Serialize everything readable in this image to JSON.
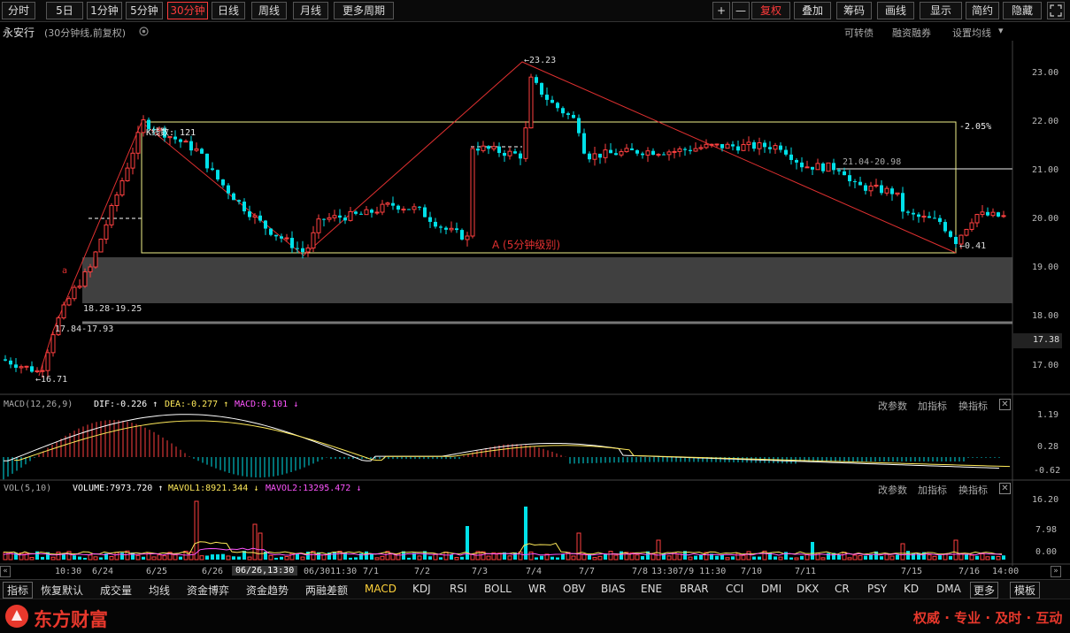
{
  "toolbar": {
    "periods": [
      "分时",
      "5日",
      "1分钟",
      "5分钟",
      "30分钟",
      "日线",
      "周线",
      "月线",
      "更多周期"
    ],
    "right": [
      "+",
      "—",
      "复权",
      "叠加",
      "筹码",
      "画线",
      "显示",
      "简约",
      "隐藏"
    ],
    "active_period": "30分钟"
  },
  "info": {
    "stock_name": "永安行",
    "mode": "(30分钟线,前复权)",
    "links": [
      "可转债",
      "融资融券",
      "设置均线"
    ]
  },
  "main_chart": {
    "yaxis": [
      "23.00",
      "22.00",
      "21.00",
      "20.00",
      "19.00",
      "18.00",
      "17.00"
    ],
    "current_price": "17.38",
    "annotations": {
      "high": "23.23",
      "low": "16.71",
      "low2": "0.41",
      "kline_count": "K线数: 121",
      "pct": "-2.05%",
      "center_label": "A (5分钟级别)",
      "zone1": "18.28-19.25",
      "zone2": "17.84-17.93",
      "zone3": "21.04-20.98",
      "point_a": "a"
    }
  },
  "macd": {
    "title": "MACD(12,26,9)",
    "dif": "DIF:-0.226",
    "dea": "DEA:-0.277",
    "macd": "MACD:0.101",
    "links": [
      "改参数",
      "加指标",
      "换指标"
    ],
    "yaxis": [
      "1.19",
      "0.28",
      "-0.62"
    ]
  },
  "vol": {
    "title": "VOL(5,10)",
    "volume": "VOLUME:7973.720",
    "mavol1": "MAVOL1:8921.344",
    "mavol2": "MAVOL2:13295.472",
    "links": [
      "改参数",
      "加指标",
      "换指标"
    ],
    "yaxis": [
      "16.20",
      "7.98",
      "0.00"
    ]
  },
  "xaxis": {
    "labels": [
      "10:30",
      "6/24",
      "6/25",
      "6/26",
      "06/26,13:30",
      "06/3011:30",
      "7/1",
      "7/2",
      "7/3",
      "7/4",
      "7/7",
      "7/8",
      "13:307/9 11:30",
      "7/10",
      "7/11",
      "7/15",
      "7/16",
      "14:00"
    ]
  },
  "tabs": {
    "items": [
      "指标",
      "恢复默认",
      "成交量",
      "均线",
      "资金博弈",
      "资金趋势",
      "两融差额",
      "MACD",
      "KDJ",
      "RSI",
      "BOLL",
      "WR",
      "OBV",
      "BIAS",
      "ENE",
      "BRAR",
      "CCI",
      "DMI",
      "DKX",
      "CR",
      "PSY",
      "KD",
      "DMA",
      "更多",
      "模板"
    ],
    "selected": "MACD"
  },
  "footer": {
    "brand": "东方财富",
    "slogan": "权威 · 专业 · 及时 · 互动"
  },
  "colors": {
    "up": "#ff4040",
    "down": "#00e0e8",
    "box": "#f0f08a",
    "trend": "#e03030"
  }
}
